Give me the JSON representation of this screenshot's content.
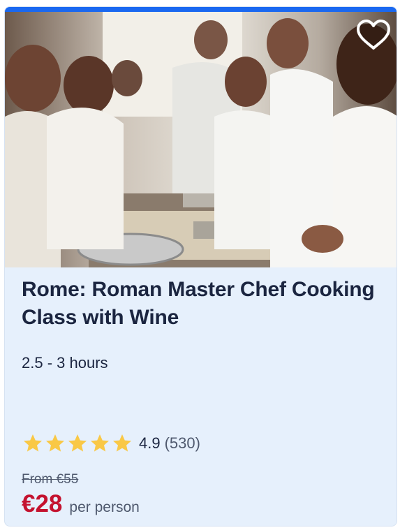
{
  "card": {
    "title": "Rome: Roman Master Chef Cooking Class with Wine",
    "duration": "2.5 - 3 hours",
    "rating": {
      "value": "4.9",
      "count": "(530)",
      "stars": 5,
      "star_color": "#f9c846"
    },
    "original_price": "From €55",
    "price": "€28",
    "price_suffix": "per person",
    "favorite_icon": "heart-outline-icon",
    "colors": {
      "accent_bar": "#1a68f0",
      "background": "#e6f0fc",
      "title": "#1b2540",
      "price": "#c4122f"
    }
  }
}
